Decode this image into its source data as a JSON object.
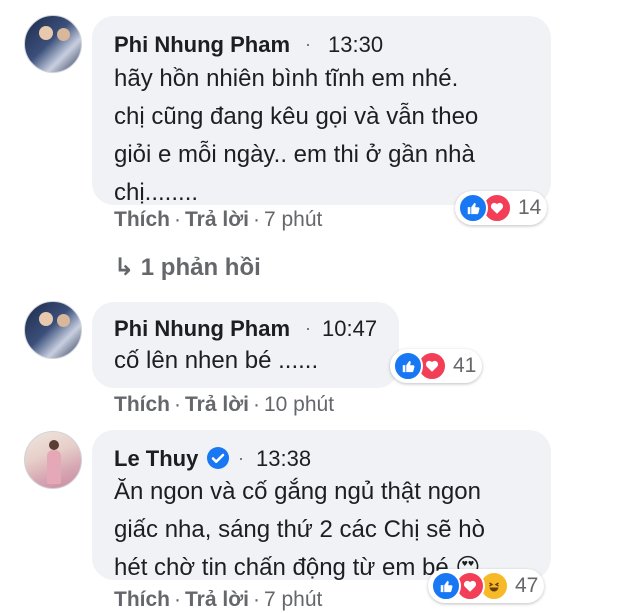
{
  "comments": [
    {
      "author": "Phi Nhung Pham",
      "time": "13:30",
      "text": "hãy hồn nhiên bình tĩnh em nhé.\nchị cũng đang kêu gọi và vẫn theo\ngiỏi e mỗi ngày.. em thi ở gần nhà\nchị........",
      "actions": {
        "like": "Thích",
        "reply": "Trả lời",
        "age": "7 phút"
      },
      "reactions": {
        "icons": [
          "like-icon",
          "love-icon"
        ],
        "count": "14"
      }
    },
    {
      "author": "Phi Nhung Pham",
      "time": "10:47",
      "text": "cố lên nhen bé ......",
      "actions": {
        "like": "Thích",
        "reply": "Trả lời",
        "age": "10 phút"
      },
      "reactions": {
        "icons": [
          "like-icon",
          "love-icon"
        ],
        "count": "41"
      }
    },
    {
      "author": "Le Thuy",
      "verified": true,
      "time": "13:38",
      "text": "Ăn ngon và cố gắng ngủ thật ngon\ngiấc nha, sáng thứ 2 các Chị sẽ hò\nhét chờ tin chấn động từ em bé 😍",
      "actions": {
        "like": "Thích",
        "reply": "Trả lời",
        "age": "7 phút"
      },
      "reactions": {
        "icons": [
          "like-icon",
          "love-icon",
          "haha-icon"
        ],
        "count": "47"
      }
    }
  ],
  "replies_link": "↳ 1 phản hồi",
  "separator": "·",
  "colors": {
    "like": "#1877f2",
    "love": "#f33e58",
    "haha": "#f7b928",
    "bubble": "#f0f2f5",
    "meta": "#65676b"
  }
}
